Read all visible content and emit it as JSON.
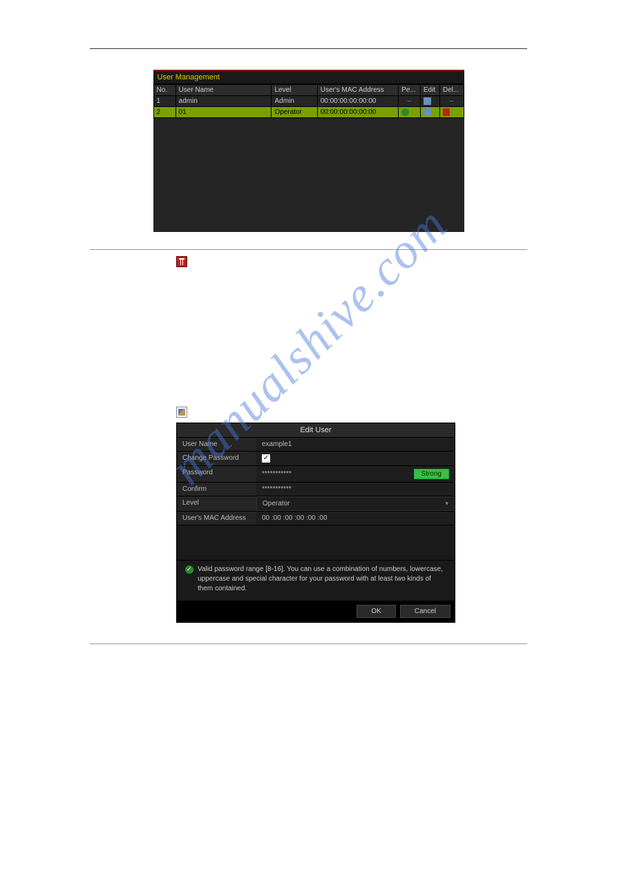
{
  "watermark": "manualshive.com",
  "shot1": {
    "title": "User Management",
    "headers": [
      "No.",
      "User Name",
      "Level",
      "User's MAC Address",
      "Pe...",
      "Edit",
      "Del..."
    ],
    "rows": [
      {
        "no": "1",
        "user": "admin",
        "level": "Admin",
        "mac": "00:00:00:00:00:00"
      },
      {
        "no": "2",
        "user": "01",
        "level": "Operator",
        "mac": "00:00:00:00:00:00"
      }
    ]
  },
  "shot2": {
    "title": "Edit User",
    "labels": {
      "username": "User Name",
      "changepw": "Change Password",
      "password": "Password",
      "confirm": "Confirm",
      "level": "Level",
      "mac": "User's MAC Address"
    },
    "values": {
      "username": "example1",
      "password": "***********",
      "confirm": "***********",
      "level": "Operator",
      "mac": "00  :00  :00  :00  :00  :00",
      "strength": "Strong"
    },
    "hint": "Valid password range [8-16]. You can use a combination of numbers, lowercase, uppercase and special character for your password with at least two kinds of them contained.",
    "ok": "OK",
    "cancel": "Cancel"
  }
}
